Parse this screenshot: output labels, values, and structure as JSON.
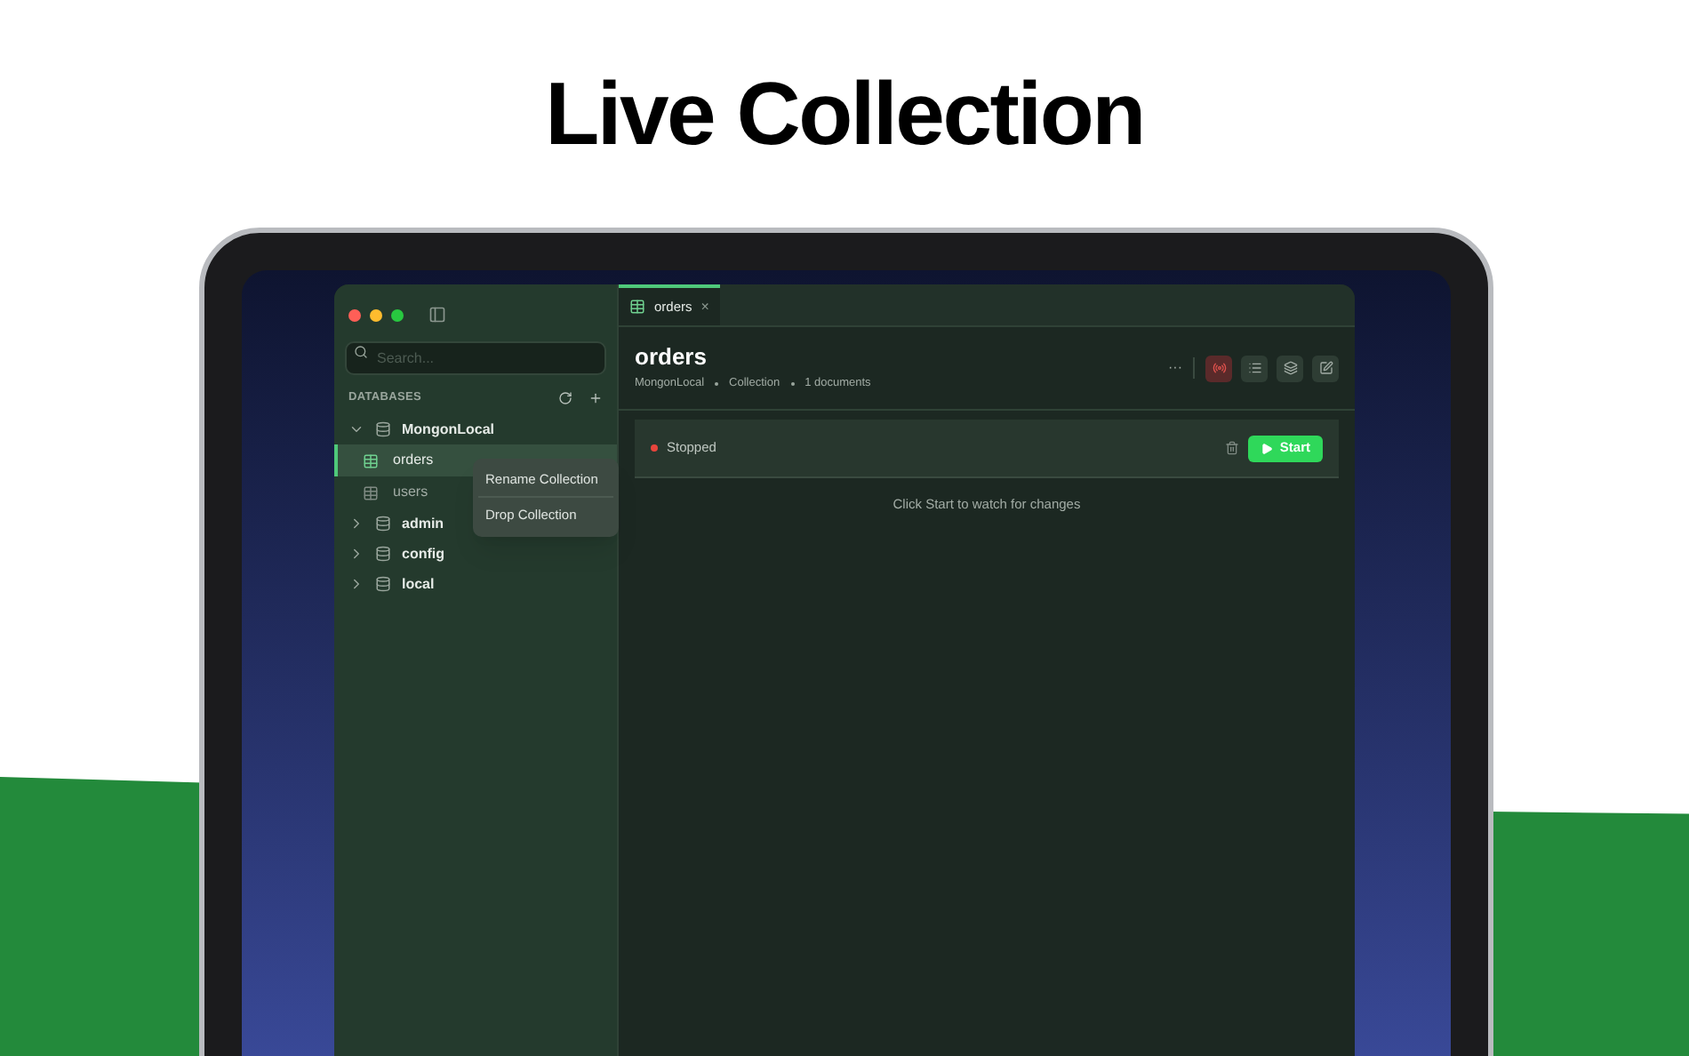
{
  "headline": "Live Collection",
  "sidebar": {
    "search": {
      "placeholder": "Search..."
    },
    "section_title": "DATABASES",
    "tree": [
      {
        "label": "MongonLocal",
        "kind": "database",
        "expanded": true,
        "children": [
          {
            "label": "orders",
            "kind": "collection",
            "selected": true
          },
          {
            "label": "users",
            "kind": "collection",
            "selected": false
          }
        ]
      },
      {
        "label": "admin",
        "kind": "database",
        "expanded": false
      },
      {
        "label": "config",
        "kind": "database",
        "expanded": false
      },
      {
        "label": "local",
        "kind": "database",
        "expanded": false
      }
    ],
    "context_menu": [
      "Rename Collection",
      "Drop Collection"
    ]
  },
  "tabs": [
    {
      "label": "orders",
      "selected": true,
      "close": "×"
    }
  ],
  "header": {
    "title": "orders",
    "meta": [
      "MongonLocal",
      "Collection",
      "1 documents"
    ],
    "more": "···",
    "tools": [
      {
        "kind": "live",
        "selected": true
      },
      {
        "kind": "list",
        "selected": false
      },
      {
        "kind": "layers",
        "selected": false
      },
      {
        "kind": "edit",
        "selected": false
      }
    ]
  },
  "live": {
    "status": "Stopped",
    "running": false,
    "start_label": "Start",
    "hint": "Click Start to watch for changes"
  }
}
